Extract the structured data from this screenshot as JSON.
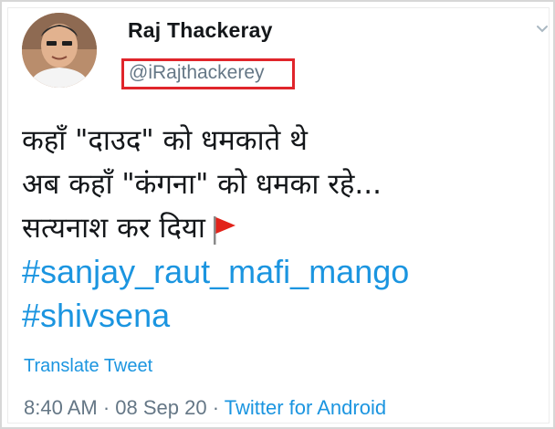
{
  "user": {
    "display_name": "Raj Thackeray",
    "handle": "@iRajthackerey"
  },
  "tweet": {
    "lines": [
      "कहाँ \"दाउद\" को धमकाते थे",
      "अब कहाँ \"कंगना\" को धमका रहे...",
      "सत्यनाश कर दिया"
    ],
    "hashtags": [
      "#sanjay_raut_mafi_mango",
      "#shivsena"
    ],
    "emoji": "flag-icon",
    "translate_label": "Translate Tweet"
  },
  "meta": {
    "time": "8:40 AM",
    "separator": "·",
    "date": "08 Sep 20",
    "source": "Twitter for Android"
  },
  "colors": {
    "link": "#1b95e0",
    "muted": "#657786",
    "text": "#14171a",
    "highlight_box": "#e0252b",
    "flag": "#e2231a"
  }
}
